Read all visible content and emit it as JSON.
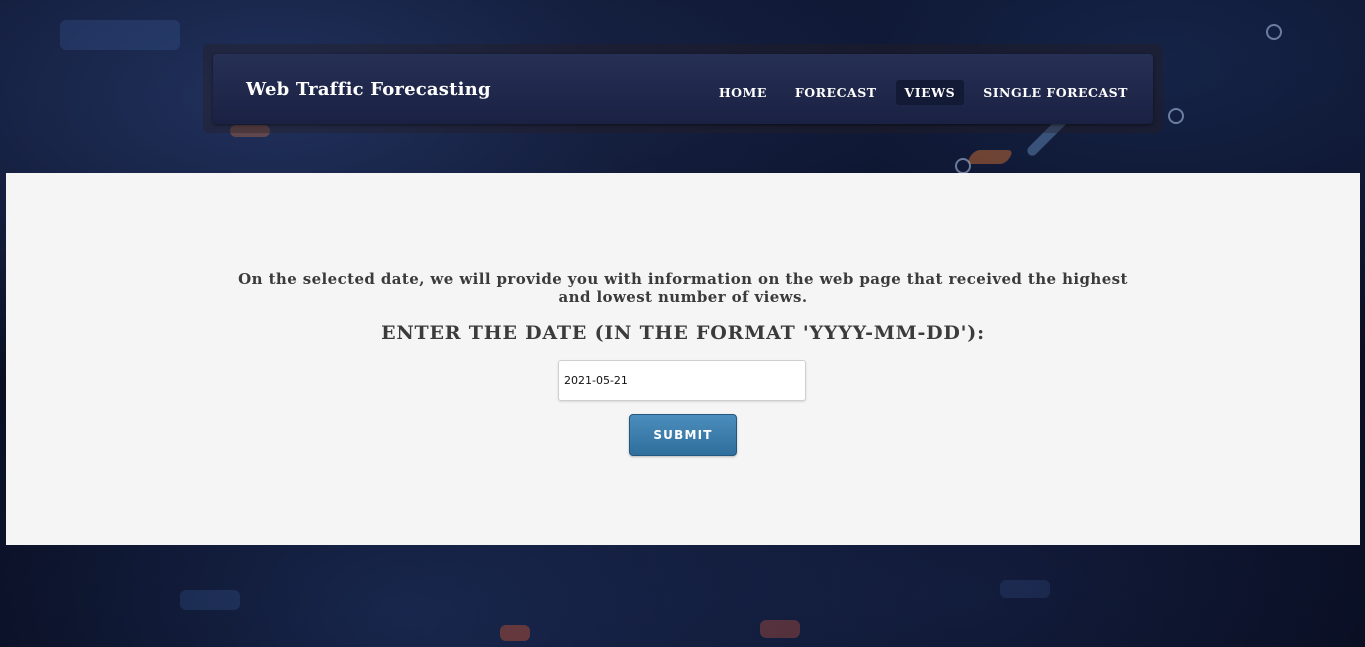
{
  "header": {
    "brand": "Web Traffic Forecasting",
    "nav": [
      {
        "label": "HOME",
        "active": false
      },
      {
        "label": "FORECAST",
        "active": false
      },
      {
        "label": "VIEWS",
        "active": true
      },
      {
        "label": "SINGLE FORECAST",
        "active": false
      }
    ]
  },
  "main": {
    "intro_text": "On the selected date, we will provide you with information on the web page that received the highest and lowest number of views.",
    "prompt_text": "ENTER THE DATE (IN THE FORMAT 'YYYY-MM-DD'):",
    "date_input": {
      "value": "2021-05-21"
    },
    "submit_label": "SUBMIT"
  },
  "colors": {
    "navbar": "#232b50",
    "active_nav": "#131a36",
    "panel": "#f5f5f5",
    "submit": "#3a7cab",
    "text": "#3b3b3b"
  }
}
